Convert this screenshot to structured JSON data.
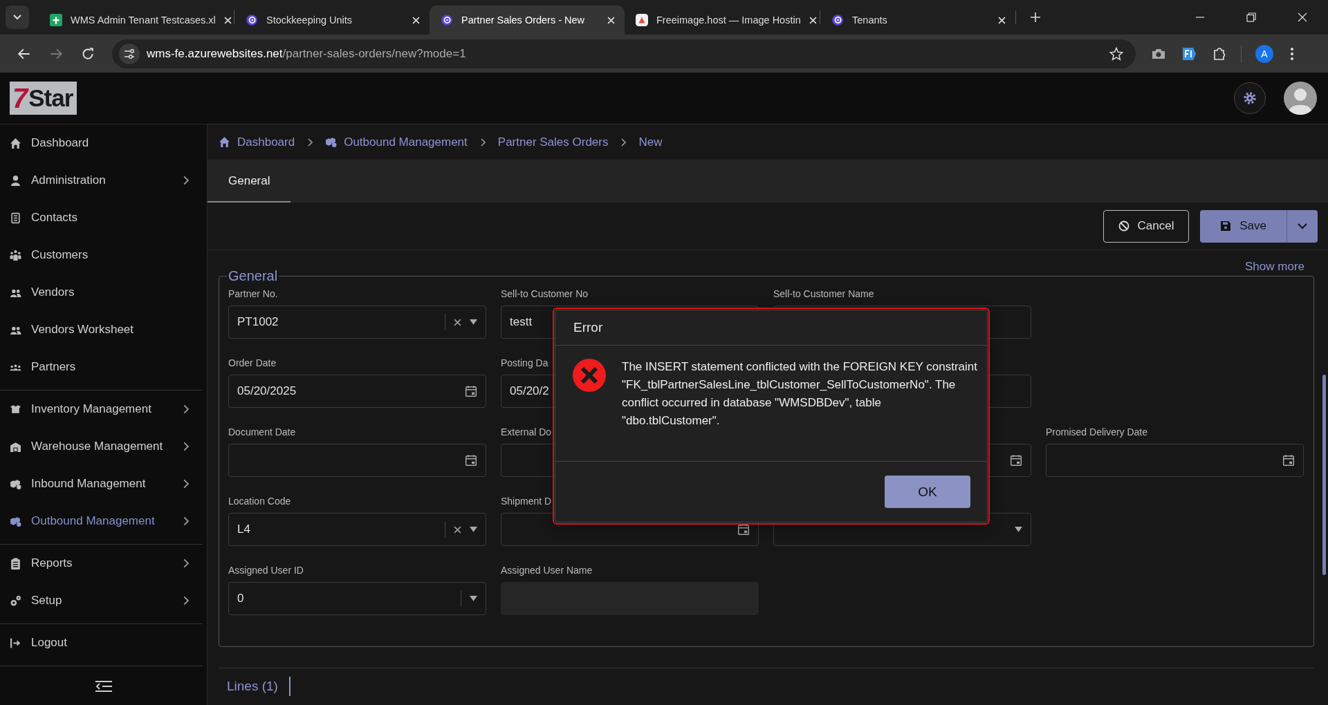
{
  "browser": {
    "tabs": [
      {
        "title": "WMS Admin Tenant Testcases.xl",
        "kind": "sheets",
        "selected": false
      },
      {
        "title": "Stockkeeping Units",
        "kind": "app",
        "selected": false
      },
      {
        "title": "Partner Sales Orders - New",
        "kind": "app",
        "selected": true
      },
      {
        "title": "Freeimage.host — Image Hostin",
        "kind": "image-host",
        "selected": false
      },
      {
        "title": "Tenants",
        "kind": "app",
        "selected": false
      }
    ],
    "url_host": "wms-fe.azurewebsites.net",
    "url_path": "/partner-sales-orders/new?mode=1",
    "profile": "A"
  },
  "logo": {
    "mark": "7",
    "text": "Star"
  },
  "sidebar": {
    "groups": [
      [
        {
          "label": "Dashboard",
          "kind": "home",
          "expandable": false,
          "selected": false
        },
        {
          "label": "Administration",
          "kind": "user",
          "expandable": true,
          "selected": false
        },
        {
          "label": "Contacts",
          "kind": "book",
          "expandable": false,
          "selected": false
        },
        {
          "label": "Customers",
          "kind": "crowd",
          "expandable": false,
          "selected": false
        },
        {
          "label": "Vendors",
          "kind": "users",
          "expandable": false,
          "selected": false
        },
        {
          "label": "Vendors Worksheet",
          "kind": "users",
          "expandable": false,
          "selected": false
        },
        {
          "label": "Partners",
          "kind": "group",
          "expandable": false,
          "selected": false
        }
      ],
      [
        {
          "label": "Inventory Management",
          "kind": "box",
          "expandable": true,
          "selected": false
        },
        {
          "label": "Warehouse Management",
          "kind": "warehouse",
          "expandable": true,
          "selected": false
        },
        {
          "label": "Inbound Management",
          "kind": "boxes",
          "expandable": true,
          "selected": false
        },
        {
          "label": "Outbound Management",
          "kind": "boxes",
          "expandable": true,
          "selected": true
        }
      ],
      [
        {
          "label": "Reports",
          "kind": "clipboard",
          "expandable": true,
          "selected": false
        },
        {
          "label": "Setup",
          "kind": "gears",
          "expandable": true,
          "selected": false
        }
      ],
      [
        {
          "label": "Logout",
          "kind": "logout",
          "expandable": false,
          "selected": false
        }
      ]
    ]
  },
  "breadcrumb": [
    {
      "label": "Dashboard",
      "kind": "home"
    },
    {
      "label": "Outbound Management",
      "kind": "boxes"
    },
    {
      "label": "Partner Sales Orders"
    },
    {
      "label": "New"
    }
  ],
  "tabs": [
    {
      "label": "General",
      "selected": true
    }
  ],
  "toolbar": {
    "cancel": "Cancel",
    "save": "Save"
  },
  "show_more": "Show more",
  "section": {
    "title": "General",
    "rows": [
      [
        {
          "label": "Partner No.",
          "value": "PT1002",
          "kind": "combo-clear"
        },
        {
          "label": "Sell-to Customer No",
          "value": "testt",
          "kind": "text"
        },
        {
          "label": "Sell-to Customer Name",
          "kind": "text"
        }
      ],
      [
        {
          "label": "Order Date",
          "value": "05/20/2025",
          "kind": "date"
        },
        {
          "label": "Posting Da",
          "value": "05/20/2",
          "kind": "text"
        },
        {
          "kind": "text"
        }
      ],
      [
        {
          "label": "Document Date",
          "kind": "date"
        },
        {
          "label": "External Do",
          "kind": "text"
        },
        {
          "kind": "date"
        },
        {
          "label": "Promised Delivery Date",
          "kind": "date"
        }
      ],
      [
        {
          "label": "Location Code",
          "value": "L4",
          "kind": "combo-clear"
        },
        {
          "label": "Shipment D",
          "kind": "date"
        },
        {
          "kind": "dropdown"
        }
      ],
      [
        {
          "label": "Assigned User ID",
          "value": "0",
          "kind": "combo"
        },
        {
          "label": "Assigned User Name",
          "kind": "readonly"
        }
      ]
    ]
  },
  "lines_tab": {
    "label": "Lines (1)"
  },
  "dialog": {
    "title": "Error",
    "message": "The INSERT statement conflicted with the FOREIGN KEY constraint \"FK_tblPartnerSalesLine_tblCustomer_SellToCustomerNo\". The conflict occurred in database \"WMSDBDev\", table \"dbo.tblCustomer\".",
    "ok": "OK"
  }
}
